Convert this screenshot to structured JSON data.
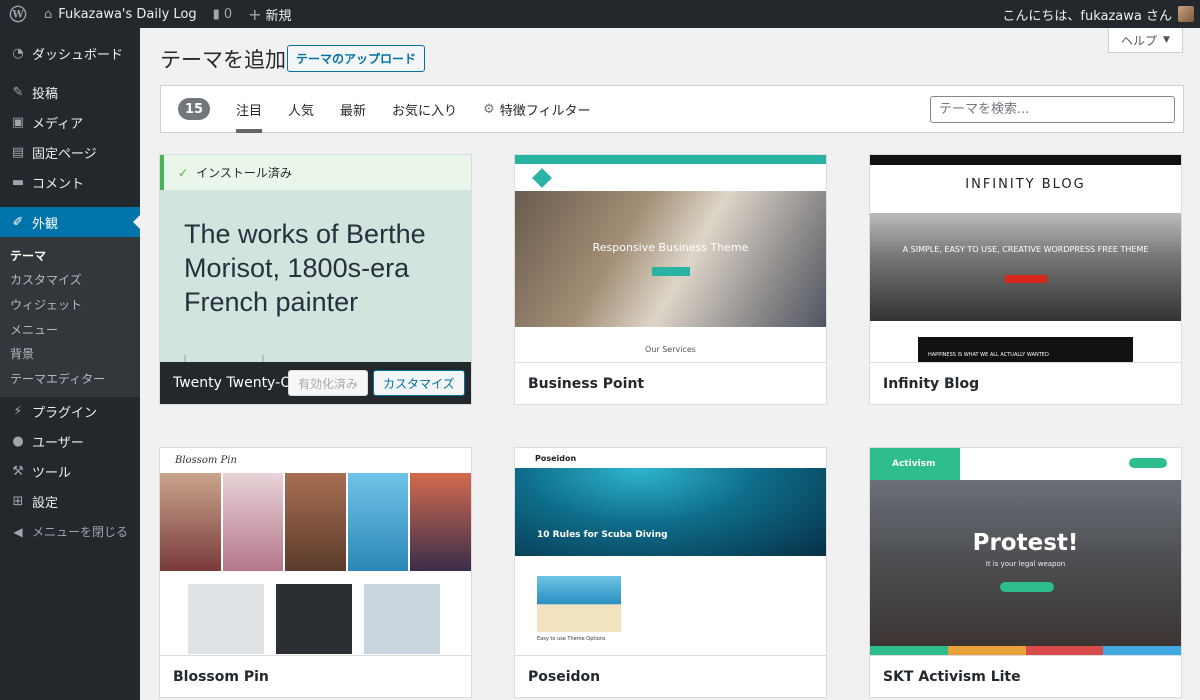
{
  "admin_bar": {
    "site_name": "Fukazawa's Daily Log",
    "comments_count": "0",
    "new_label": "新規",
    "greeting": "こんにちは、fukazawa さん"
  },
  "sidebar": {
    "items": [
      {
        "label": "ダッシュボード",
        "icon": "dashboard-icon"
      },
      {
        "label": "投稿",
        "icon": "pushpin-icon"
      },
      {
        "label": "メディア",
        "icon": "media-icon"
      },
      {
        "label": "固定ページ",
        "icon": "page-icon"
      },
      {
        "label": "コメント",
        "icon": "comment-icon"
      },
      {
        "label": "外観",
        "icon": "brush-icon"
      },
      {
        "label": "プラグイン",
        "icon": "plugin-icon"
      },
      {
        "label": "ユーザー",
        "icon": "user-icon"
      },
      {
        "label": "ツール",
        "icon": "wrench-icon"
      },
      {
        "label": "設定",
        "icon": "settings-icon"
      },
      {
        "label": "メニューを閉じる",
        "icon": "collapse-icon"
      }
    ],
    "submenu": [
      "テーマ",
      "カスタマイズ",
      "ウィジェット",
      "メニュー",
      "背景",
      "テーマエディター"
    ]
  },
  "header": {
    "title": "テーマを追加",
    "upload_label": "テーマのアップロード",
    "help_label": "ヘルプ"
  },
  "filter": {
    "count": "15",
    "tabs": [
      "注目",
      "人気",
      "最新",
      "お気に入り"
    ],
    "feature_filter": "特徴フィルター",
    "search_placeholder": "テーマを検索..."
  },
  "active_theme": {
    "installed_label": "インストール済み",
    "preview_text": "The works of Berthe Morisot, 1800s-era French painter",
    "name": "Twenty Twenty-One",
    "activated_label": "有効化済み",
    "customize_label": "カスタマイズ"
  },
  "themes": [
    {
      "name": "Business Point",
      "preview_headline": "Responsive Business Theme",
      "preview_section": "Our Services"
    },
    {
      "name": "Infinity Blog",
      "preview_headline": "INFINITY BLOG",
      "preview_tagline": "A SIMPLE, EASY TO USE, CREATIVE WORDPRESS FREE THEME",
      "preview_band": "HAPPINESS IS WHAT WE ALL ACTUALLY WANTED"
    },
    {
      "name": "Blossom Pin",
      "preview_logo": "Blossom Pin"
    },
    {
      "name": "Poseidon",
      "preview_logo": "Poseidon",
      "preview_headline": "10 Rules for Scuba Diving",
      "preview_caption": "Easy to use Theme Options"
    },
    {
      "name": "SKT Activism Lite",
      "preview_logo": "Activism",
      "preview_headline": "Protest!",
      "preview_subtitle": "It is your legal weapon"
    }
  ]
}
